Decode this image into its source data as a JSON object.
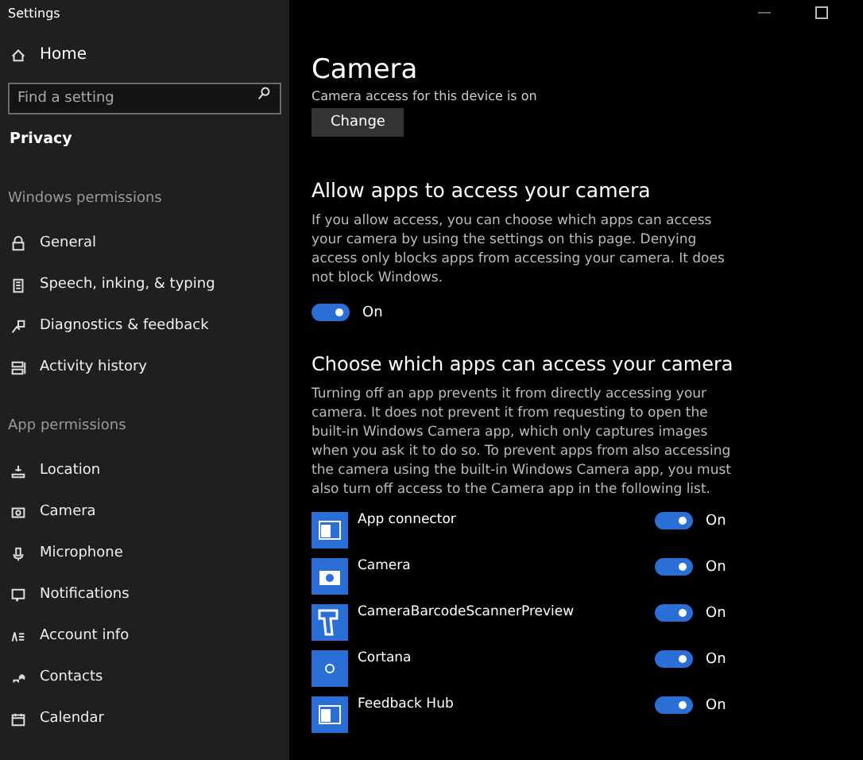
{
  "window": {
    "title": "Settings"
  },
  "sidebar": {
    "home": "Home",
    "search": {
      "placeholder": "Find a setting"
    },
    "section_title": "Privacy",
    "groups": [
      {
        "title": "Windows permissions",
        "items": [
          {
            "label": "General",
            "kind": "lock",
            "selected": false
          },
          {
            "label": "Speech, inking, & typing",
            "kind": "clipboard",
            "selected": false
          },
          {
            "label": "Diagnostics & feedback",
            "kind": "person",
            "selected": false
          },
          {
            "label": "Activity history",
            "kind": "history",
            "selected": false
          }
        ]
      },
      {
        "title": "App permissions",
        "items": [
          {
            "label": "Location",
            "kind": "location",
            "selected": false
          },
          {
            "label": "Camera",
            "kind": "camera",
            "selected": false
          },
          {
            "label": "Microphone",
            "kind": "mic",
            "selected": false
          },
          {
            "label": "Notifications",
            "kind": "message",
            "selected": false
          },
          {
            "label": "Account info",
            "kind": "account",
            "selected": false
          },
          {
            "label": "Contacts",
            "kind": "contacts",
            "selected": false
          },
          {
            "label": "Calendar",
            "kind": "calendar",
            "selected": false
          }
        ]
      }
    ]
  },
  "main": {
    "title": "Camera",
    "device_status": "Camera access for this device is on",
    "change_button": "Change",
    "allow": {
      "heading": "Allow apps to access your camera",
      "description": "If you allow access, you can choose which apps can access your camera by using the settings on this page. Denying access only blocks apps from accessing your camera. It does not block Windows.",
      "toggle": {
        "on": true,
        "label": "On"
      }
    },
    "apps_section": {
      "heading": "Choose which apps can access your camera",
      "description": "Turning off an app prevents it from directly accessing your camera. It does not prevent it from requesting to open the built-in Windows Camera app, which only captures images when you ask it to do so. To prevent apps from also accessing the camera using the built-in Windows Camera app, you must also turn off access to the Camera app in the following list.",
      "apps": [
        {
          "name": "App connector",
          "kind": "window",
          "toggle": {
            "on": true,
            "label": "On"
          }
        },
        {
          "name": "Camera",
          "kind": "camera",
          "toggle": {
            "on": true,
            "label": "On"
          }
        },
        {
          "name": "CameraBarcodeScannerPreview",
          "kind": "scanner",
          "toggle": {
            "on": true,
            "label": "On"
          }
        },
        {
          "name": "Cortana",
          "kind": "circle",
          "toggle": {
            "on": true,
            "label": "On"
          }
        },
        {
          "name": "Feedback Hub",
          "kind": "window",
          "toggle": {
            "on": true,
            "label": "On"
          }
        }
      ]
    }
  }
}
